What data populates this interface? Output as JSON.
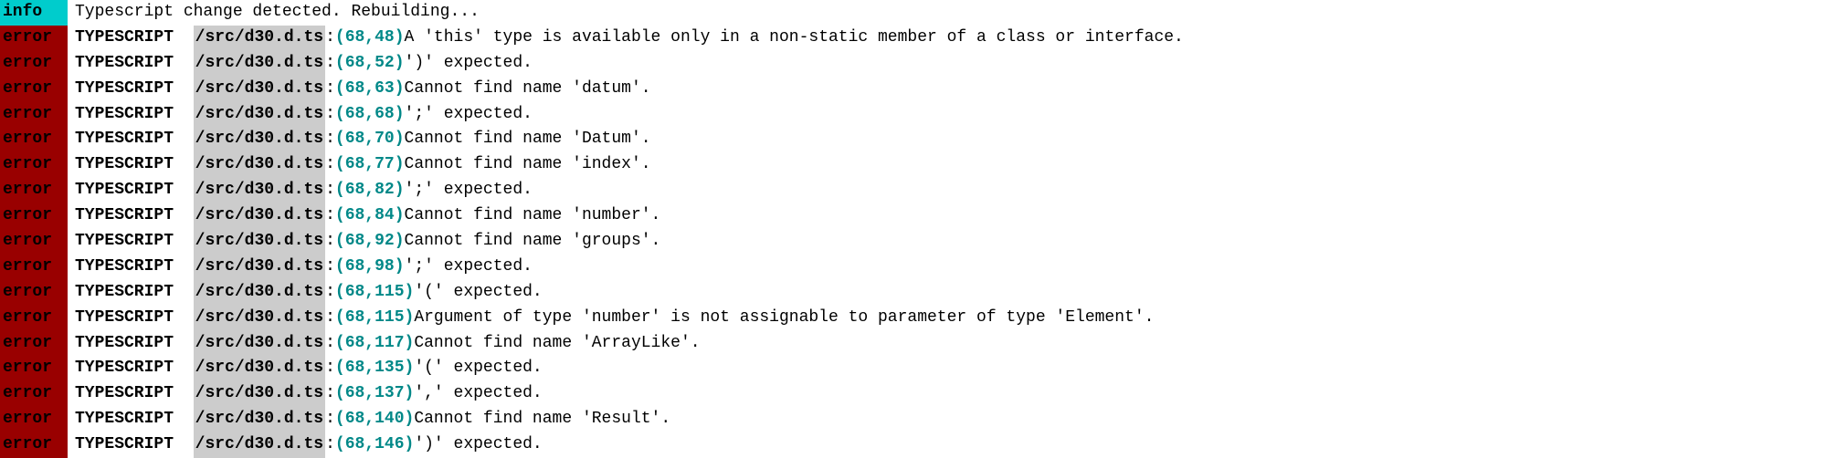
{
  "info_badge": "info",
  "error_badge": "error",
  "info_message": "Typescript change detected. Rebuilding...",
  "ts_label": "TYPESCRIPT",
  "file_path": "/src/d30.d.ts",
  "errors": [
    {
      "loc": "(68,48)",
      "msg": "A 'this' type is available only in a non-static member of a class or interface."
    },
    {
      "loc": "(68,52)",
      "msg": "')' expected."
    },
    {
      "loc": "(68,63)",
      "msg": "Cannot find name 'datum'."
    },
    {
      "loc": "(68,68)",
      "msg": "';' expected."
    },
    {
      "loc": "(68,70)",
      "msg": "Cannot find name 'Datum'."
    },
    {
      "loc": "(68,77)",
      "msg": "Cannot find name 'index'."
    },
    {
      "loc": "(68,82)",
      "msg": "';' expected."
    },
    {
      "loc": "(68,84)",
      "msg": "Cannot find name 'number'."
    },
    {
      "loc": "(68,92)",
      "msg": "Cannot find name 'groups'."
    },
    {
      "loc": "(68,98)",
      "msg": "';' expected."
    },
    {
      "loc": "(68,115)",
      "msg": "'(' expected."
    },
    {
      "loc": "(68,115)",
      "msg": "Argument of type 'number' is not assignable to parameter of type 'Element'."
    },
    {
      "loc": "(68,117)",
      "msg": "Cannot find name 'ArrayLike'."
    },
    {
      "loc": "(68,135)",
      "msg": "'(' expected."
    },
    {
      "loc": "(68,137)",
      "msg": "',' expected."
    },
    {
      "loc": "(68,140)",
      "msg": "Cannot find name 'Result'."
    },
    {
      "loc": "(68,146)",
      "msg": "')' expected."
    }
  ]
}
